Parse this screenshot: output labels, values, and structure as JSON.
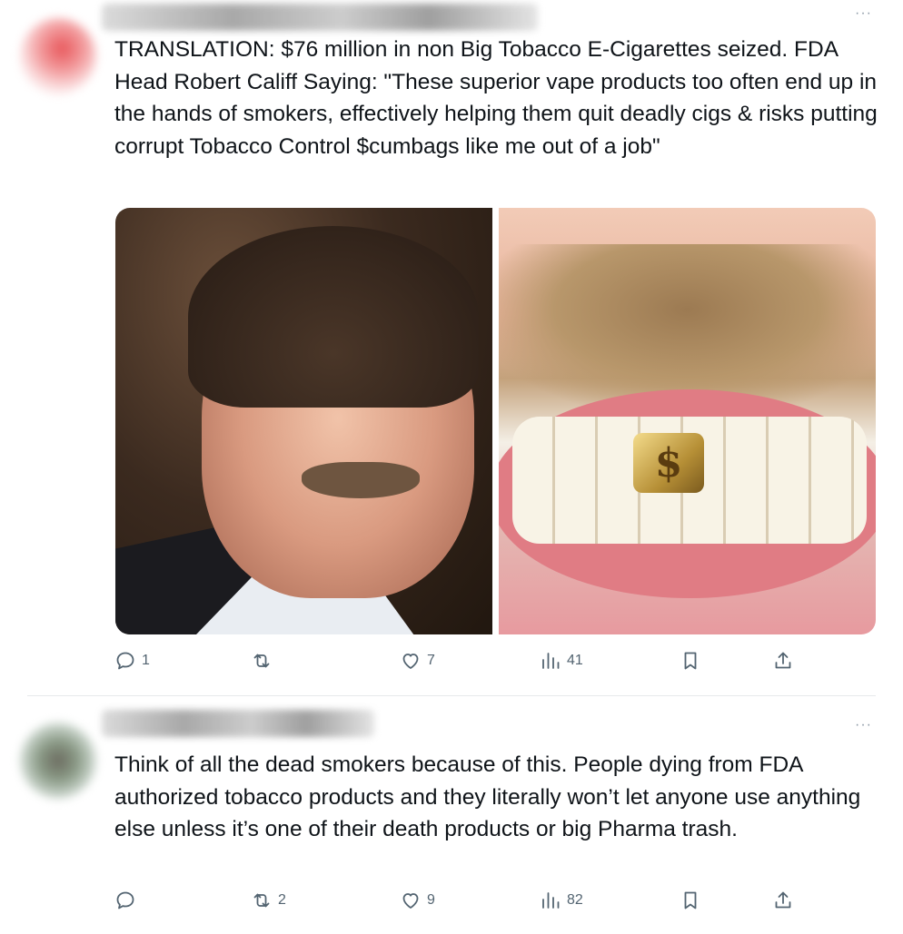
{
  "tweets": [
    {
      "text": "TRANSLATION: $76 million in non Big Tobacco E-Cigarettes seized. FDA Head Robert Califf Saying: \"These superior vape products too often end up in the hands of smokers, effectively helping them quit deadly cigs & risks putting corrupt Tobacco Control $cumbags like me out of a job\"",
      "more": "···",
      "media": {
        "right_symbol": "$"
      },
      "actions": {
        "replies": "1",
        "retweets": "",
        "likes": "7",
        "views": "41"
      }
    },
    {
      "text": "Think of all the dead smokers because of this. People dying from FDA authorized tobacco products and they literally won’t let anyone use anything else unless it’s one of their death products or big Pharma trash.",
      "more": "···",
      "actions": {
        "replies": "",
        "retweets": "2",
        "likes": "9",
        "views": "82"
      }
    }
  ],
  "icons": [
    "reply-icon",
    "retweet-icon",
    "like-icon",
    "views-icon",
    "bookmark-icon",
    "share-icon",
    "more-icon"
  ]
}
